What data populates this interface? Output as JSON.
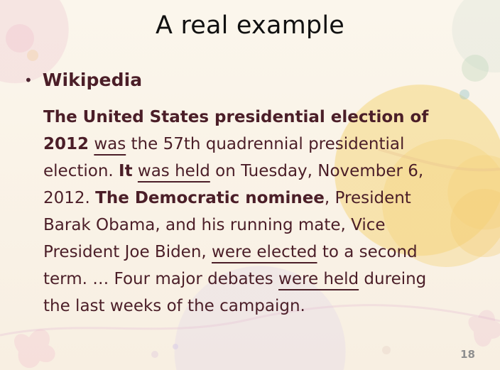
{
  "slide": {
    "title": "A real example",
    "page_number": "18",
    "bullet": {
      "label": "Wikipedia"
    },
    "paragraph": {
      "line_1": {
        "part_1": "The United States presidential election of"
      },
      "line_2": {
        "part_1": "2012",
        "part_2": " ",
        "part_3": "was",
        "part_4": " the 57th quadrennial presidential"
      },
      "line_3": {
        "part_1": "election. ",
        "part_2": "It",
        "part_3": " ",
        "part_4": "was held",
        "part_5": " on Tuesday, November 6,"
      },
      "line_4": {
        "part_1": "2012. ",
        "part_2": "The Democratic nominee",
        "part_3": ", President"
      },
      "line_5": {
        "part_1": "Barak Obama, and his running mate, Vice"
      },
      "line_6": {
        "part_1": "President Joe Biden, ",
        "part_2": "were elected",
        "part_3": " to a second"
      },
      "line_7": {
        "part_1": "term. … Four major debates ",
        "part_2": "were held",
        "part_3": " dureing"
      },
      "line_8": {
        "part_1": "the last weeks of the campaign."
      }
    }
  },
  "colors": {
    "title": "#111111",
    "body": "#4b1e28",
    "page_number": "#8f8f8f",
    "background": "#f8f1e4",
    "accent_yellow": "#f3d07a"
  }
}
